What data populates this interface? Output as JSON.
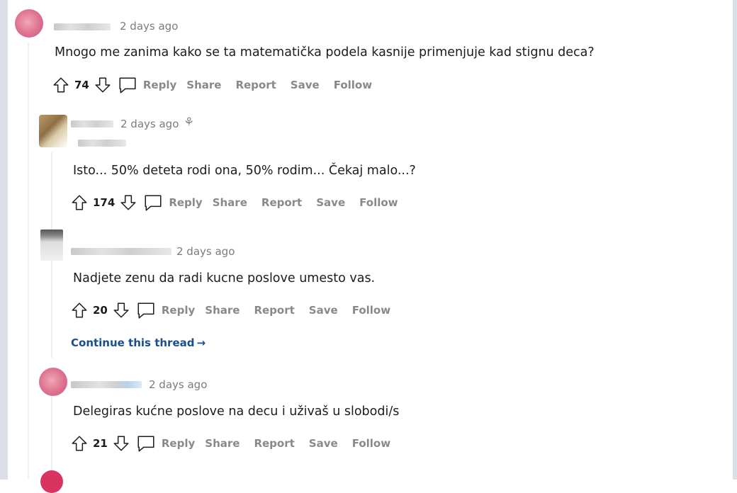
{
  "comments": [
    {
      "time": "2 days ago",
      "text": "Mnogo me zanima kako se ta matematička podela kasnije primenjuje kad stignu deca?",
      "votes": "74",
      "avatar_color": "#e07b94"
    },
    {
      "time": "2 days ago",
      "text": "Isto... 50% deteta rodi ona, 50% rodim... Čekaj malo...?",
      "votes": "174",
      "has_award": true
    },
    {
      "time": "2 days ago",
      "text": "Nadjete zenu da radi kucne poslove umesto vas.",
      "votes": "20"
    },
    {
      "time": "2 days ago",
      "text": "Delegiras kućne poslove na decu i uživaš u slobodi/s",
      "votes": "21",
      "avatar_color": "#e07b94"
    }
  ],
  "actions": {
    "reply": "Reply",
    "share": "Share",
    "report": "Report",
    "save": "Save",
    "follow": "Follow"
  },
  "continue_thread": "Continue this thread",
  "colors": {
    "link": "#1a4f8b",
    "muted": "#878a8c",
    "thread_line": "#edeff1",
    "side_bar": "#dae0e6"
  },
  "icons": [
    "upvote-icon",
    "downvote-icon",
    "reply-bubble-icon",
    "award-icon",
    "arrow-right-icon"
  ]
}
